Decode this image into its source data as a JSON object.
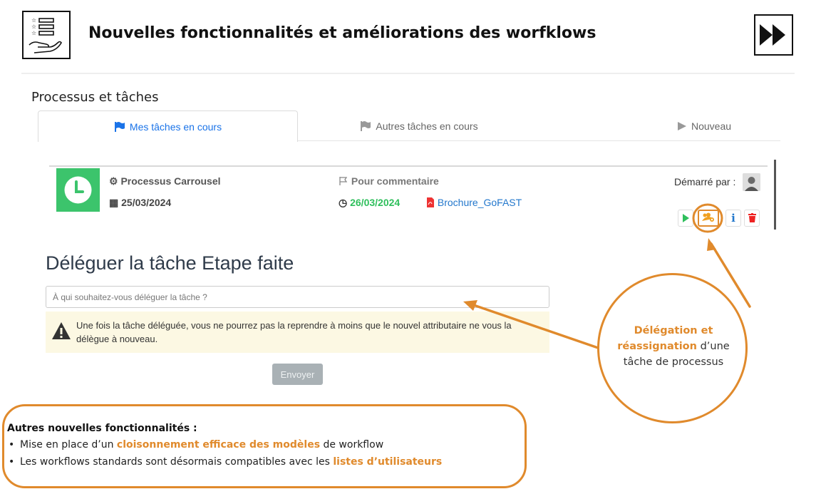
{
  "header": {
    "title": "Nouvelles fonctionnalités et améliorations des worfklows"
  },
  "section": {
    "title": "Processus et tâches"
  },
  "tabs": [
    {
      "label": "Mes tâches en cours",
      "active": true
    },
    {
      "label": "Autres tâches en cours",
      "active": false
    },
    {
      "label": "Nouveau",
      "active": false
    }
  ],
  "task": {
    "process_name": "Processus Carrousel",
    "start_date": "25/03/2024",
    "type": "Pour commentaire",
    "due_date": "26/03/2024",
    "document": "Brochure_GoFAST",
    "started_by_label": "Démarré par :"
  },
  "delegate": {
    "title": "Déléguer la tâche Etape faite",
    "input_placeholder": "À qui souhaitez-vous déléguer la tâche ?",
    "input_value": "",
    "warning": "Une fois la tâche déléguée, vous ne pourrez pas la reprendre à moins que le nouvel attributaire ne vous la délègue à nouveau.",
    "send_label": "Envoyer"
  },
  "callout": {
    "highlight": "Délégation et réassignation",
    "rest": " d’une tâche de processus"
  },
  "bottom": {
    "title": "Autres nouvelles fonctionnalités :",
    "item1_pre": "Mise en place d’un ",
    "item1_hl": "cloisonnement efficace des modèles",
    "item1_post": " de workflow",
    "item2_pre": "Les workflows standards sont désormais compatibles avec les ",
    "item2_hl": "listes d’utilisateurs"
  },
  "colors": {
    "accent": "#e08a2c",
    "tab_active": "#1a73e8",
    "status_green": "#3cc46c",
    "warning_bg": "#fcf8e3"
  },
  "icons": [
    "checklist-hand-icon",
    "fast-forward-icon",
    "flag-icon",
    "play-icon",
    "cogs-icon",
    "calendar-icon",
    "outline-flag-icon",
    "clock-icon",
    "pdf-icon",
    "users-cog-icon",
    "info-icon",
    "trash-icon",
    "warning-icon"
  ]
}
